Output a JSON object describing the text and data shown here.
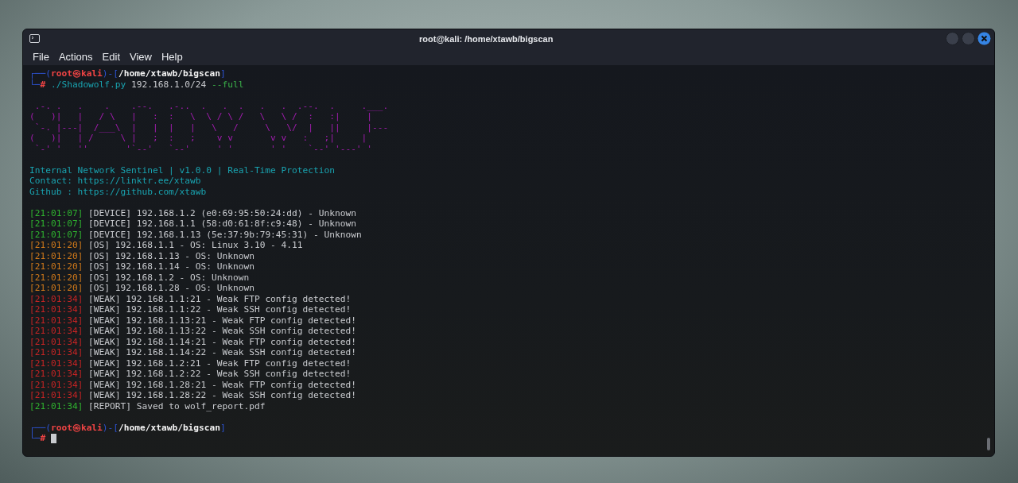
{
  "window": {
    "title": "root@kali: /home/xtawb/bigscan"
  },
  "menu": [
    "File",
    "Actions",
    "Edit",
    "View",
    "Help"
  ],
  "terminal": {
    "prompt": [
      [
        {
          "text": "┌──(",
          "kind": "frame"
        },
        {
          "text": "root㉿kali",
          "kind": "user"
        },
        {
          "text": ")-[",
          "kind": "frame"
        },
        {
          "text": "/home/xtawb/bigscan",
          "kind": "path"
        },
        {
          "text": "]",
          "kind": "frame"
        }
      ],
      [
        {
          "text": "└─",
          "kind": "frame"
        },
        {
          "text": "#",
          "kind": "symbol"
        },
        {
          "text": " ./Shadowolf.py",
          "kind": "command"
        },
        {
          "text": " 192.168.1.0/24",
          "kind": "arg"
        },
        {
          "text": " --full",
          "kind": "flag"
        }
      ]
    ],
    "banner": [
      " .-. .   .    .    .--.   .-..  .   .  .   .   .  .--.  .     .___.",
      "(   )|   |   / \\   |   :  :   \\  \\ / \\ /   \\   \\ /  :   :|     |",
      " `-. |---|  /___\\  |   |  |   |   \\   /     \\   \\/  |   ||     |---",
      "(   )|   | /     \\ |   ;  :   ;    v v       v v   :   ;|     |",
      " `-' '   ''       '`--'   `--'     ' '       ' '    `--' '---' '"
    ],
    "info": [
      "Internal Network Sentinel | v1.0.0 | Real-Time Protection",
      "Contact: https://linktr.ee/xtawb",
      "Github : https://github.com/xtawb"
    ],
    "log": [
      {
        "kind": "device",
        "time": "[21:01:07]",
        "text": "[DEVICE] 192.168.1.2 (e0:69:95:50:24:dd) - Unknown"
      },
      {
        "kind": "device",
        "time": "[21:01:07]",
        "text": "[DEVICE] 192.168.1.1 (58:d0:61:8f:c9:48) - Unknown"
      },
      {
        "kind": "device",
        "time": "[21:01:07]",
        "text": "[DEVICE] 192.168.1.13 (5e:37:9b:79:45:31) - Unknown"
      },
      {
        "kind": "os",
        "time": "[21:01:20]",
        "text": "[OS] 192.168.1.1 - OS: Linux 3.10 - 4.11"
      },
      {
        "kind": "os",
        "time": "[21:01:20]",
        "text": "[OS] 192.168.1.13 - OS: Unknown"
      },
      {
        "kind": "os",
        "time": "[21:01:20]",
        "text": "[OS] 192.168.1.14 - OS: Unknown"
      },
      {
        "kind": "os",
        "time": "[21:01:20]",
        "text": "[OS] 192.168.1.2 - OS: Unknown"
      },
      {
        "kind": "os",
        "time": "[21:01:20]",
        "text": "[OS] 192.168.1.28 - OS: Unknown"
      },
      {
        "kind": "weak",
        "time": "[21:01:34]",
        "text": "[WEAK] 192.168.1.1:21 - Weak FTP config detected!"
      },
      {
        "kind": "weak",
        "time": "[21:01:34]",
        "text": "[WEAK] 192.168.1.1:22 - Weak SSH config detected!"
      },
      {
        "kind": "weak",
        "time": "[21:01:34]",
        "text": "[WEAK] 192.168.1.13:21 - Weak FTP config detected!"
      },
      {
        "kind": "weak",
        "time": "[21:01:34]",
        "text": "[WEAK] 192.168.1.13:22 - Weak SSH config detected!"
      },
      {
        "kind": "weak",
        "time": "[21:01:34]",
        "text": "[WEAK] 192.168.1.14:21 - Weak FTP config detected!"
      },
      {
        "kind": "weak",
        "time": "[21:01:34]",
        "text": "[WEAK] 192.168.1.14:22 - Weak SSH config detected!"
      },
      {
        "kind": "weak",
        "time": "[21:01:34]",
        "text": "[WEAK] 192.168.1.2:21 - Weak FTP config detected!"
      },
      {
        "kind": "weak",
        "time": "[21:01:34]",
        "text": "[WEAK] 192.168.1.2:22 - Weak SSH config detected!"
      },
      {
        "kind": "weak",
        "time": "[21:01:34]",
        "text": "[WEAK] 192.168.1.28:21 - Weak FTP config detected!"
      },
      {
        "kind": "weak",
        "time": "[21:01:34]",
        "text": "[WEAK] 192.168.1.28:22 - Weak SSH config detected!"
      },
      {
        "kind": "report",
        "time": "[21:01:34]",
        "text": "[REPORT] Saved to wolf_report.pdf"
      }
    ],
    "final_prompt": [
      [
        {
          "text": "┌──(",
          "kind": "frame"
        },
        {
          "text": "root㉿kali",
          "kind": "user"
        },
        {
          "text": ")-[",
          "kind": "frame"
        },
        {
          "text": "/home/xtawb/bigscan",
          "kind": "path"
        },
        {
          "text": "]",
          "kind": "frame"
        }
      ],
      [
        {
          "text": "└─",
          "kind": "frame"
        },
        {
          "text": "#",
          "kind": "symbol"
        }
      ]
    ]
  }
}
